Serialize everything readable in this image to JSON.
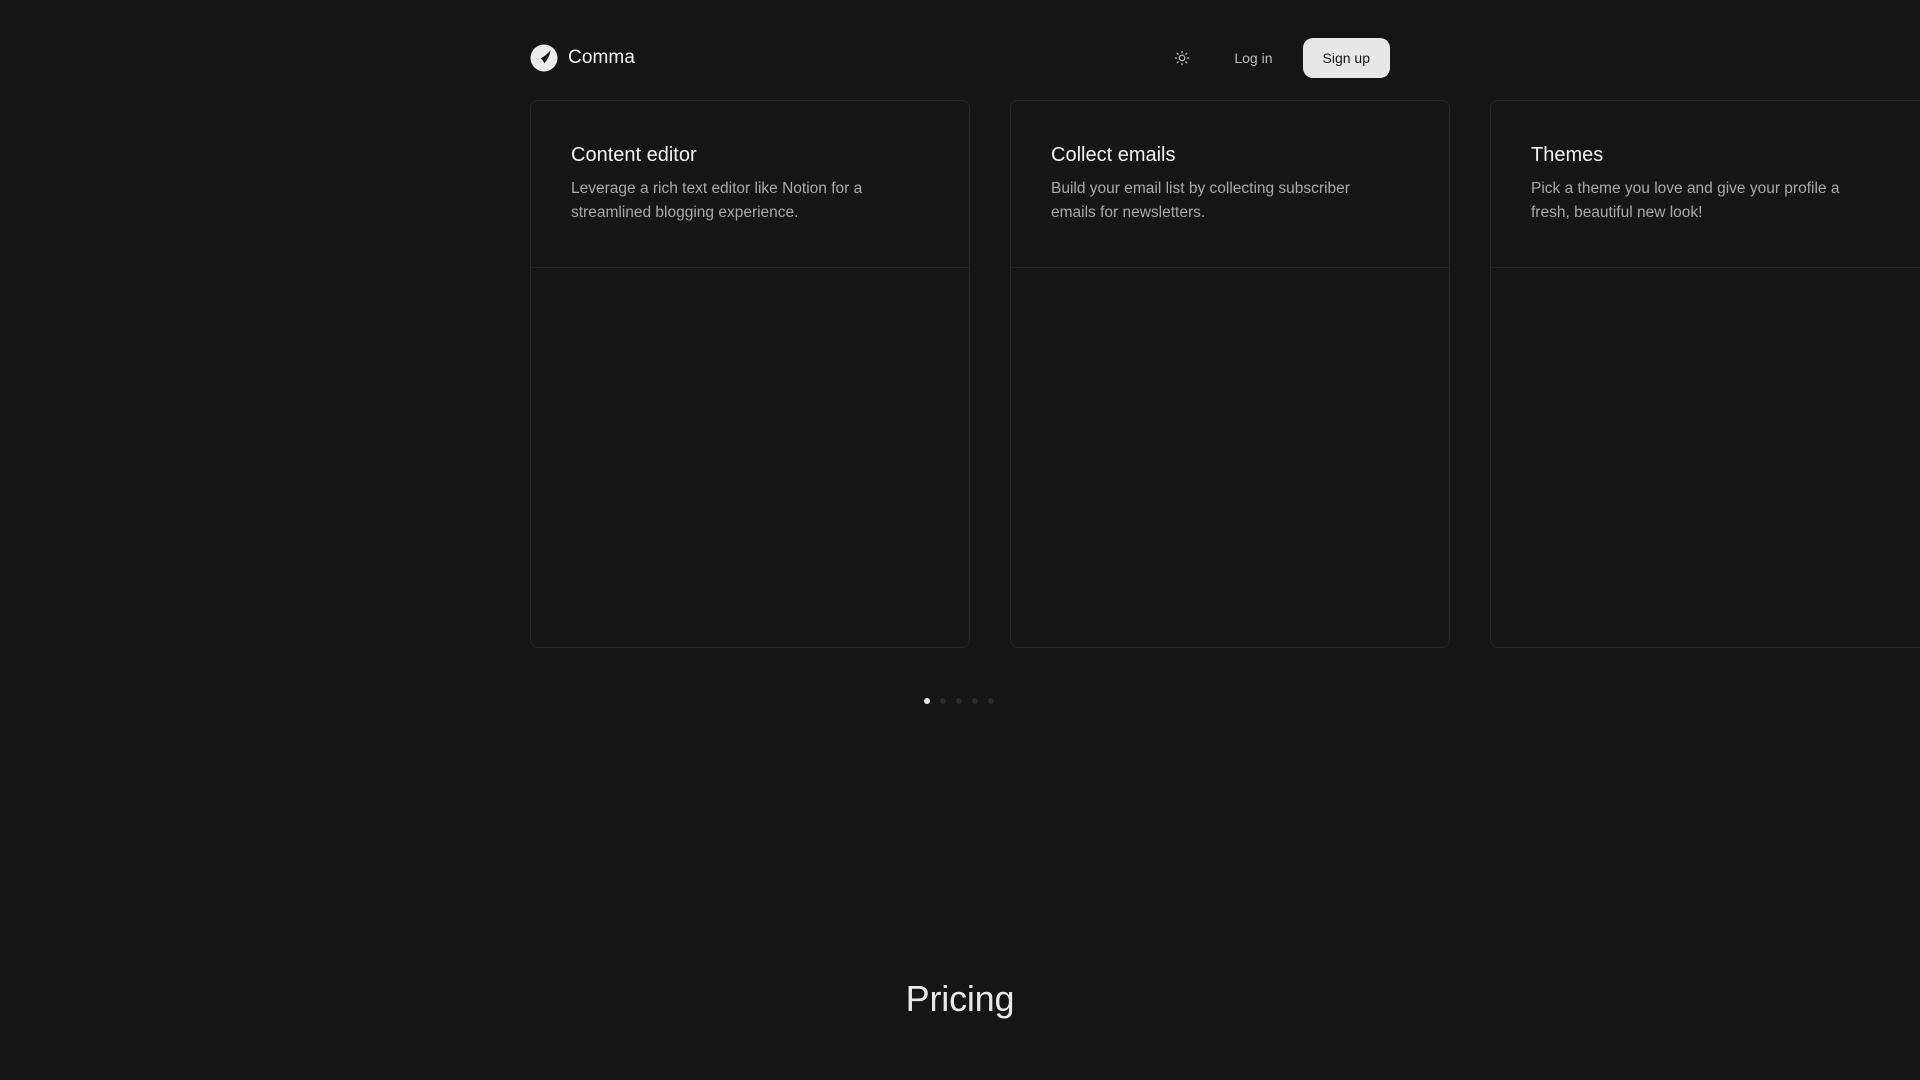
{
  "header": {
    "brand_name": "Comma",
    "login_label": "Log in",
    "signup_label": "Sign up"
  },
  "features": [
    {
      "title": "Content editor",
      "description": "Leverage a rich text editor like Notion for a streamlined blogging experience."
    },
    {
      "title": "Collect emails",
      "description": "Build your email list by collecting subscriber emails for newsletters."
    },
    {
      "title": "Themes",
      "description": "Pick a theme you love and give your profile a fresh, beautiful new look!"
    }
  ],
  "carousel": {
    "total_slides": 5,
    "active_slide": 1
  },
  "pricing": {
    "title": "Pricing"
  },
  "colors": {
    "background": "#151515",
    "card_border": "#262626",
    "signup_bg": "#e7e7e7",
    "active_dot": "#e6e6e6",
    "inactive_dot": "#2c2c2c"
  },
  "icons": {
    "logo": "comma-logo-icon",
    "theme_toggle": "sun-icon"
  }
}
